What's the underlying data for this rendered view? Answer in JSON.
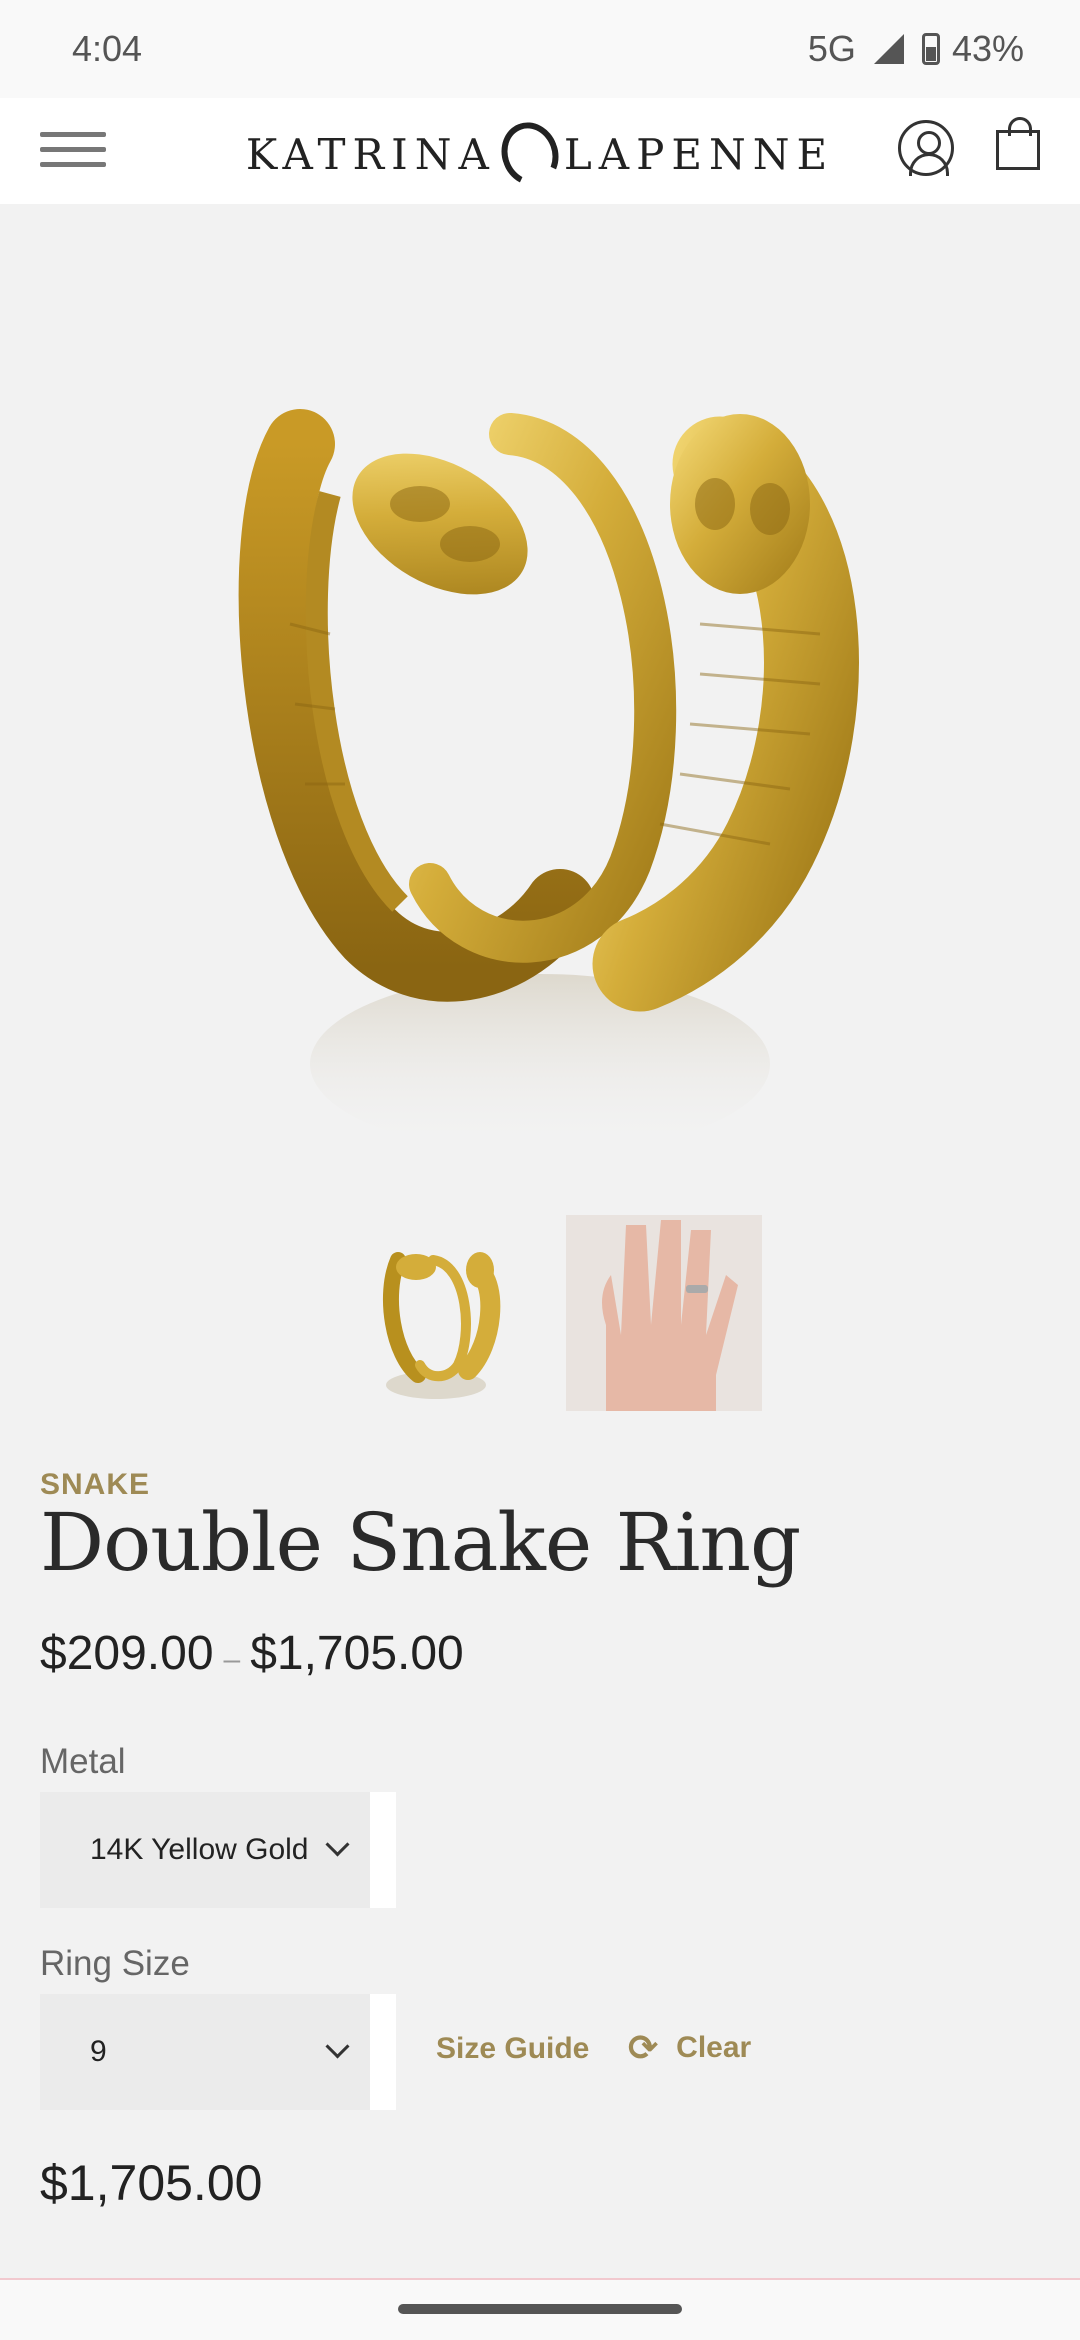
{
  "status": {
    "time": "4:04",
    "network": "5G",
    "battery": "43%"
  },
  "header": {
    "brand_left": "KATRINA",
    "brand_right": "LAPENNE",
    "menu_icon": "hamburger-icon",
    "account_icon": "account-icon",
    "cart_icon": "shopping-bag-icon"
  },
  "product": {
    "collection": "SNAKE",
    "title": "Double Snake Ring",
    "price_low": "$209.00",
    "price_sep": "–",
    "price_high": "$1,705.00",
    "metal_label": "Metal",
    "metal_value": "14K Yellow Gold",
    "size_label": "Ring Size",
    "size_value": "9",
    "size_guide": "Size Guide",
    "clear": "Clear",
    "selected_price": "$1,705.00"
  },
  "colors": {
    "accent": "#9e8a55",
    "background": "#f2f2f2",
    "gold": "#d4ad3a"
  }
}
